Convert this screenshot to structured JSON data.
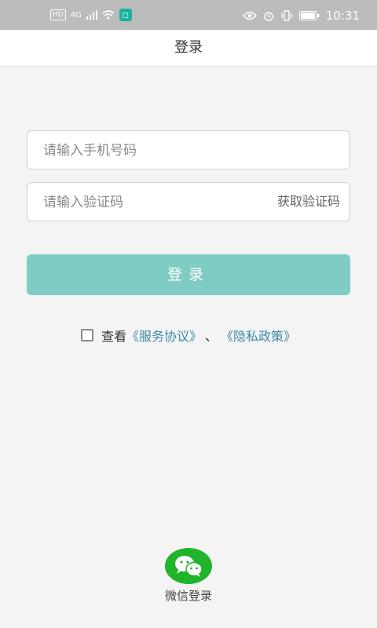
{
  "status_bar": {
    "hd": "HD",
    "network": "4G",
    "time": "10:31",
    "icons": [
      "signal-icon",
      "wifi-icon",
      "app-notification-icon",
      "eye-icon",
      "alarm-icon",
      "vibrate-icon",
      "battery-icon"
    ]
  },
  "header": {
    "title": "登录"
  },
  "form": {
    "phone_placeholder": "请输入手机号码",
    "code_placeholder": "请输入验证码",
    "get_code_label": "获取验证码",
    "login_button_label": "登录"
  },
  "agreement": {
    "prefix": "查看",
    "service_link": "《服务协议》",
    "separator": "、",
    "privacy_link": "《隐私政策》"
  },
  "wechat": {
    "label": "微信登录"
  },
  "colors": {
    "accent": "#7fccc4",
    "link": "#3c8aa6",
    "wechat": "#20b42a"
  }
}
